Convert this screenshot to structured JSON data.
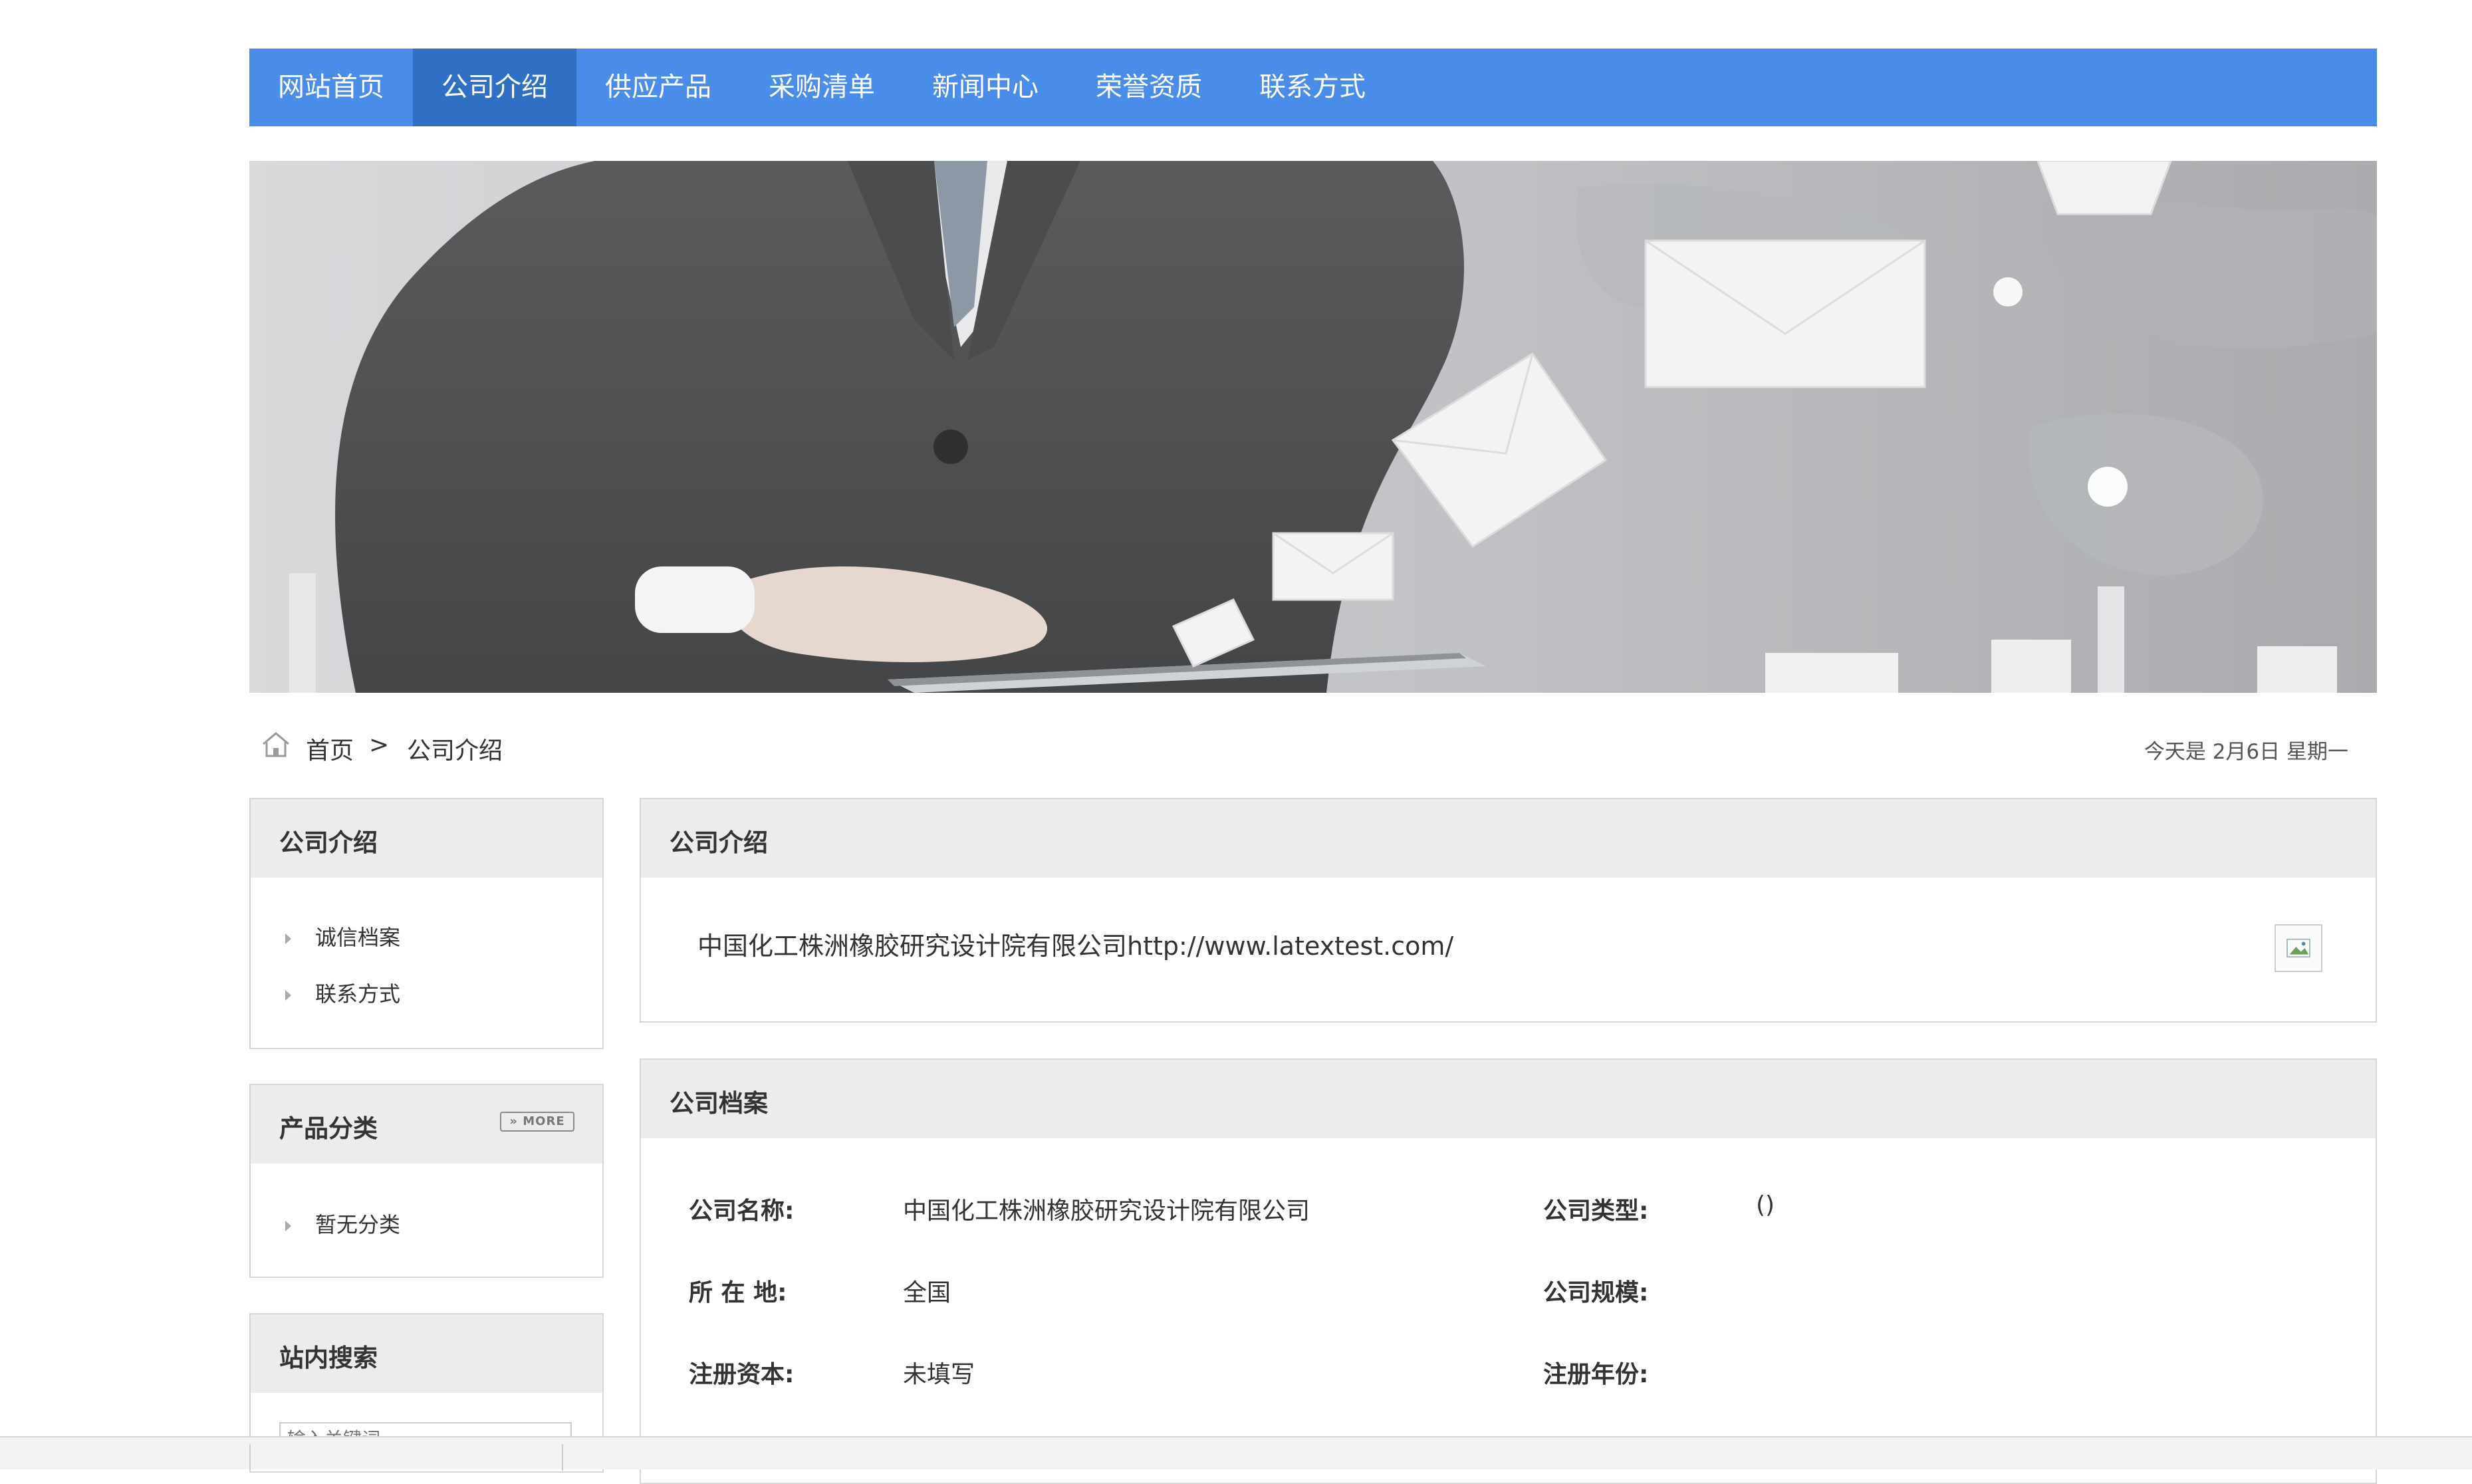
{
  "nav": {
    "items": [
      {
        "label": "网站首页"
      },
      {
        "label": "公司介绍"
      },
      {
        "label": "供应产品"
      },
      {
        "label": "采购清单"
      },
      {
        "label": "新闻中心"
      },
      {
        "label": "荣誉资质"
      },
      {
        "label": "联系方式"
      }
    ],
    "active_index": 1,
    "bg_color": "#4a8de8",
    "active_color": "#2f6fc4"
  },
  "breadcrumb": {
    "home": "首页",
    "separator": ">",
    "current": "公司介绍"
  },
  "date_text": "今天是 2月6日 星期一",
  "sidebar": {
    "intro": {
      "title": "公司介绍",
      "links": [
        {
          "label": "诚信档案"
        },
        {
          "label": "联系方式"
        }
      ]
    },
    "categories": {
      "title": "产品分类",
      "more_label": "MORE",
      "links": [
        {
          "label": "暂无分类"
        }
      ]
    },
    "search": {
      "title": "站内搜索",
      "placeholder": "输入关键词"
    }
  },
  "intro_panel": {
    "title": "公司介绍",
    "text": "中国化工株洲橡胶研究设计院有限公司http://www.latextest.com/"
  },
  "profile_panel": {
    "title": "公司档案",
    "rows": [
      {
        "label1": "公司名称:",
        "value1": "中国化工株洲橡胶研究设计院有限公司",
        "label2": "公司类型:",
        "value2": "()"
      },
      {
        "label1": "所 在 地:",
        "value1": "全国",
        "label2": "公司规模:",
        "value2": ""
      },
      {
        "label1": "注册资本:",
        "value1": "未填写",
        "label2": "注册年份:",
        "value2": ""
      }
    ]
  },
  "icons": [
    "home-icon",
    "triangle-bullet-icon",
    "broken-image-icon"
  ]
}
